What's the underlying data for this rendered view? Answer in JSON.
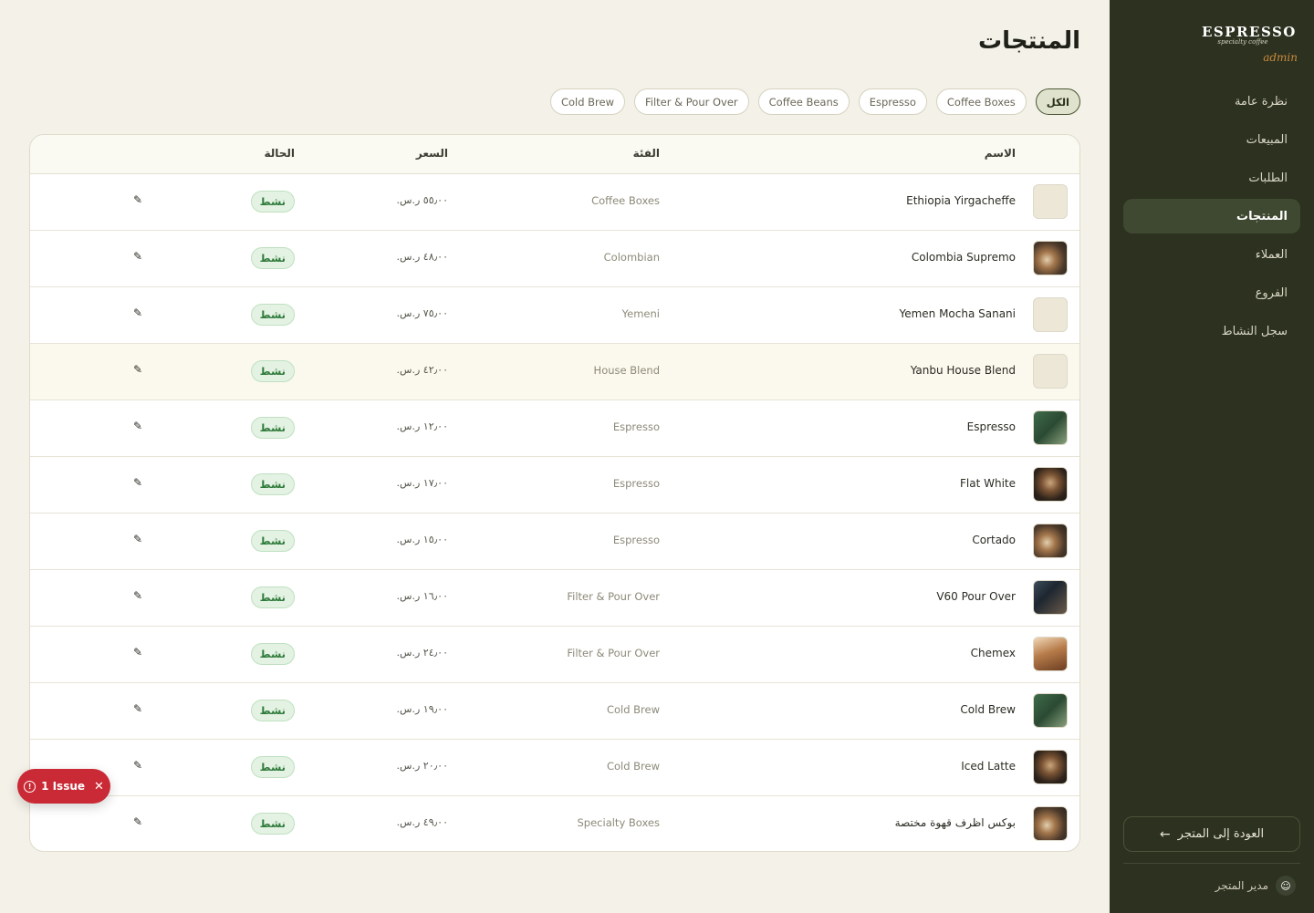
{
  "sidebar": {
    "logo_word": "ESPRESSO",
    "logo_sub": "specialty coffee",
    "admin_tag": "admin",
    "nav": [
      {
        "label": "نظرة عامة"
      },
      {
        "label": "المبيعات"
      },
      {
        "label": "الطلبات"
      },
      {
        "label": "المنتجات"
      },
      {
        "label": "العملاء"
      },
      {
        "label": "الفروع"
      },
      {
        "label": "سجل النشاط"
      }
    ],
    "active_nav": "المنتجات",
    "back_label": "العودة إلى المتجر",
    "user_label": "مدير المتجر"
  },
  "page": {
    "title": "المنتجات"
  },
  "filters": [
    "الكل",
    "Coffee Boxes",
    "Espresso",
    "Coffee Beans",
    "Filter & Pour Over",
    "Cold Brew"
  ],
  "active_filter": "الكل",
  "table": {
    "headers": {
      "name": "الاسم",
      "category": "الفئة",
      "price": "السعر",
      "status": "الحالة"
    },
    "rows": [
      {
        "name": "Ethiopia Yirgacheffe",
        "category": "Coffee Boxes",
        "price": "٥٥٫٠٠ ر.س.",
        "status": "نشط",
        "image": "placeholder"
      },
      {
        "name": "Colombia Supremo",
        "category": "Colombian",
        "price": "٤٨٫٠٠ ر.س.",
        "status": "نشط",
        "image": "photo"
      },
      {
        "name": "Yemen Mocha Sanani",
        "category": "Yemeni",
        "price": "٧٥٫٠٠ ر.س.",
        "status": "نشط",
        "image": "placeholder"
      },
      {
        "name": "Yanbu House Blend",
        "category": "House Blend",
        "price": "٤٢٫٠٠ ر.س.",
        "status": "نشط",
        "image": "placeholder"
      },
      {
        "name": "Espresso",
        "category": "Espresso",
        "price": "١٢٫٠٠ ر.س.",
        "status": "نشط",
        "image": "photo"
      },
      {
        "name": "Flat White",
        "category": "Espresso",
        "price": "١٧٫٠٠ ر.س.",
        "status": "نشط",
        "image": "photo"
      },
      {
        "name": "Cortado",
        "category": "Espresso",
        "price": "١٥٫٠٠ ر.س.",
        "status": "نشط",
        "image": "photo"
      },
      {
        "name": "V60 Pour Over",
        "category": "Filter & Pour Over",
        "price": "١٦٫٠٠ ر.س.",
        "status": "نشط",
        "image": "photo"
      },
      {
        "name": "Chemex",
        "category": "Filter & Pour Over",
        "price": "٢٤٫٠٠ ر.س.",
        "status": "نشط",
        "image": "photo"
      },
      {
        "name": "Cold Brew",
        "category": "Cold Brew",
        "price": "١٩٫٠٠ ر.س.",
        "status": "نشط",
        "image": "photo"
      },
      {
        "name": "Iced Latte",
        "category": "Cold Brew",
        "price": "٢٠٫٠٠ ر.س.",
        "status": "نشط",
        "image": "photo"
      },
      {
        "name": "بوكس اظرف قهوة مختصة",
        "category": "Specialty Boxes",
        "price": "٤٩٫٠٠ ر.س.",
        "status": "نشط",
        "image": "photo"
      }
    ],
    "edit_icon": "pencil-icon"
  },
  "issue_badge": {
    "label": "1 Issue"
  },
  "colors": {
    "sidebar_bg": "#2c3120",
    "page_bg": "#f3f1e8",
    "active_status": "#2f7a3a",
    "issue_red": "#c92a35"
  }
}
